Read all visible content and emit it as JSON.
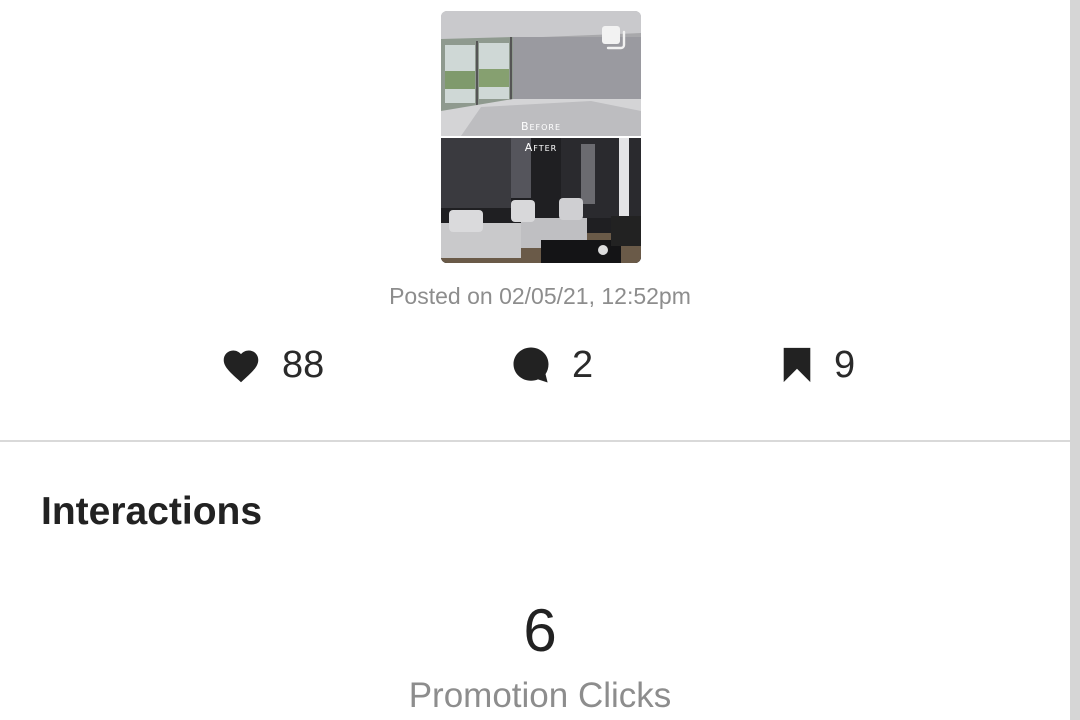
{
  "post": {
    "images": [
      {
        "caption": "Before",
        "description": "empty-room"
      },
      {
        "caption": "After",
        "description": "furnished-living-room"
      }
    ],
    "multi_image_icon": "multiple-images-icon",
    "posted_text": "Posted on 02/05/21, 12:52pm"
  },
  "stats": {
    "likes": {
      "icon": "heart-icon",
      "count": "88"
    },
    "comments": {
      "icon": "comment-icon",
      "count": "2"
    },
    "saves": {
      "icon": "bookmark-icon",
      "count": "9"
    }
  },
  "interactions": {
    "title": "Interactions",
    "metrics": [
      {
        "value": "6",
        "label": "Promotion Clicks"
      }
    ]
  },
  "colors": {
    "text_primary": "#222222",
    "text_secondary": "#8d8d8d",
    "divider": "#d9d9d9"
  }
}
